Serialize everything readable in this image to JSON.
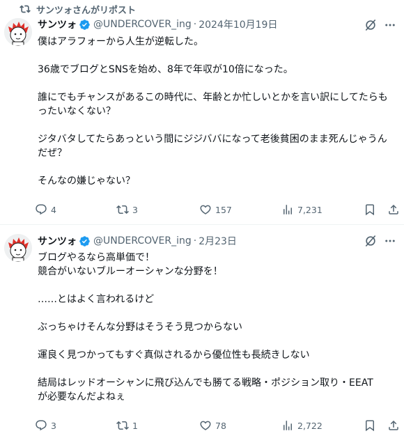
{
  "repost": {
    "label": "サンツォさんがリポスト"
  },
  "tweets": [
    {
      "name": "サンツォ",
      "handle": "@UNDERCOVER_ing",
      "separator": "·",
      "date": "2024年10月19日",
      "text": "僕はアラフォーから人生が逆転した。\n\n36歳でブログとSNSを始め、8年で年収が10倍になった。\n\n誰にでもチャンスがあるこの時代に、年齢とか忙しいとかを言い訳にしてたらもったいなくない？\n\nジタバタしてたらあっという間にジジババになって老後貧困のまま死んじゃうんだぜ？\n\nそんなの嫌じゃない？",
      "replies": "4",
      "reposts": "3",
      "likes": "157",
      "views": "7,231"
    },
    {
      "name": "サンツォ",
      "handle": "@UNDERCOVER_ing",
      "separator": "·",
      "date": "2月23日",
      "text": "ブログやるなら高単価で！\n競合がいないブルーオーシャンな分野を！\n\n……とはよく言われるけど\n\nぶっちゃけそんな分野はそうそう見つからない\n\n運良く見つかってもすぐ真似されるから優位性も長続きしない\n\n結局はレッドオーシャンに飛び込んでも勝てる戦略・ポジション取り・EEAT\nが必要なんだよねぇ",
      "replies": "3",
      "reposts": "1",
      "likes": "78",
      "views": "2,722"
    }
  ],
  "colors": {
    "text": "#0f1419",
    "muted": "#536471",
    "verified": "#1d9bf0"
  }
}
